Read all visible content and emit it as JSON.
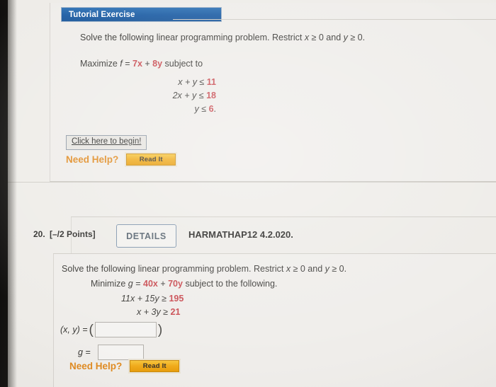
{
  "tutorial": {
    "header_label": "Tutorial Exercise",
    "prompt_intro": "Solve the following linear programming problem. Restrict ",
    "prompt_restrict_x": "x",
    "prompt_ge1": " ≥ 0 and ",
    "prompt_restrict_y": "y",
    "prompt_ge2": " ≥ 0.",
    "objective_verb": "Maximize ",
    "objective_var": "f",
    "objective_eq": " = ",
    "objective_term1": "7x",
    "objective_plus": " + ",
    "objective_term2": "8y",
    "objective_tail": " subject to",
    "constraints": [
      {
        "lhs": "x + y ≤ ",
        "rhs": "11",
        "tail": ""
      },
      {
        "lhs": "2x + y ≤ ",
        "rhs": "18",
        "tail": ""
      },
      {
        "lhs": "y ≤ ",
        "rhs": "6",
        "tail": "."
      }
    ],
    "begin_link_label": "Click here to begin!",
    "need_help_label": "Need Help?",
    "read_it_label": "Read It"
  },
  "question": {
    "number": "20.",
    "points": "[–/2 Points]",
    "details_label": "DETAILS",
    "code": "HARMATHAP12 4.2.020.",
    "prompt_intro": "Solve the following linear programming problem. Restrict ",
    "prompt_restrict_x": "x",
    "prompt_ge1": " ≥ 0 and ",
    "prompt_restrict_y": "y",
    "prompt_ge2": " ≥ 0.",
    "objective_verb": "Minimize ",
    "objective_var": "g",
    "objective_eq": " = ",
    "objective_term1": "40x",
    "objective_plus": " + ",
    "objective_term2": "70y",
    "objective_tail": " subject to the following.",
    "constraints": [
      {
        "lhs": "11x + 15y ≥ ",
        "rhs": "195"
      },
      {
        "lhs": "x +  3y ≥ ",
        "rhs": "21"
      }
    ],
    "answer_xy_label": "(x, y) =",
    "answer_xy_value": "",
    "answer_g_label": "g =",
    "answer_g_value": "",
    "need_help_label": "Need Help?",
    "read_it_label": "Read It"
  },
  "colors": {
    "header_blue": "#1d5da4",
    "accent_orange": "#e08b22",
    "number_red": "#c8494f",
    "details_blue_gray": "#53606c",
    "page_background": "#efedea"
  }
}
